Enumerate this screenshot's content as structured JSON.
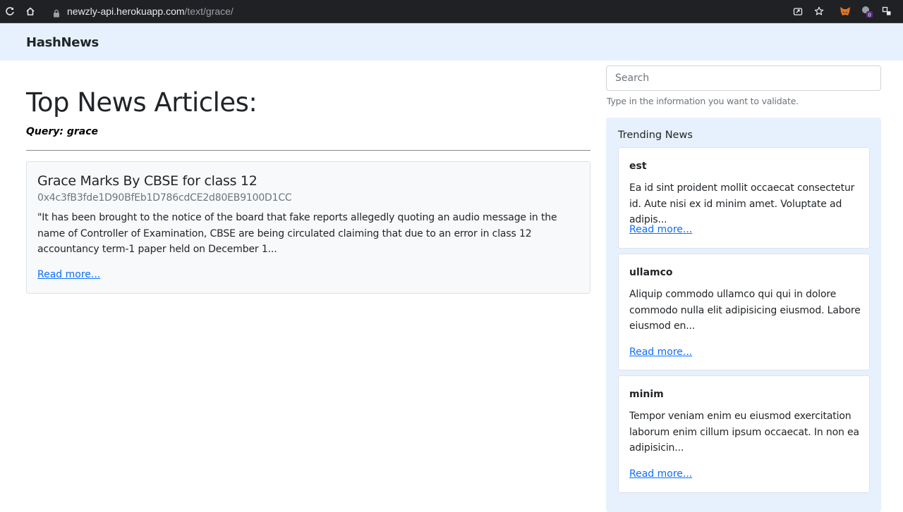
{
  "browser": {
    "url_host": "newzly-api.herokuapp.com",
    "url_path": "/text/grace/",
    "extension_badge": "0"
  },
  "navbar": {
    "brand": "HashNews"
  },
  "main": {
    "title": "Top News Articles:",
    "query": "Query: grace",
    "articles": [
      {
        "title": "Grace Marks By CBSE for class 12",
        "hash": "0x4c3fB3fde1D90BfEb1D786cdCE2d80EB9100D1CC",
        "body": "\"It has been brought to the notice of the board that fake reports allegedly quoting an audio message in the name of Controller of Examination, CBSE are being circulated claiming that due to an error in class 12 accountancy term-1 paper held on December 1...",
        "link": "Read more..."
      }
    ]
  },
  "sidebar": {
    "search": {
      "placeholder": "Search",
      "help": "Type in the information you want to validate."
    },
    "trending": {
      "title": "Trending News",
      "items": [
        {
          "title": "est",
          "text": "Ea id sint proident mollit occaecat consectetur id. Aute nisi ex id minim amet. Voluptate ad adipis...",
          "link": "Read more..."
        },
        {
          "title": "ullamco",
          "text": "Aliquip commodo ullamco qui qui in dolore commodo nulla elit adipisicing eiusmod. Labore eiusmod en...",
          "link": "Read more..."
        },
        {
          "title": "minim",
          "text": "Tempor veniam enim eu eiusmod exercitation laborum enim cillum ipsum occaecat. In non ea adipisicin...",
          "link": "Read more..."
        }
      ]
    }
  }
}
